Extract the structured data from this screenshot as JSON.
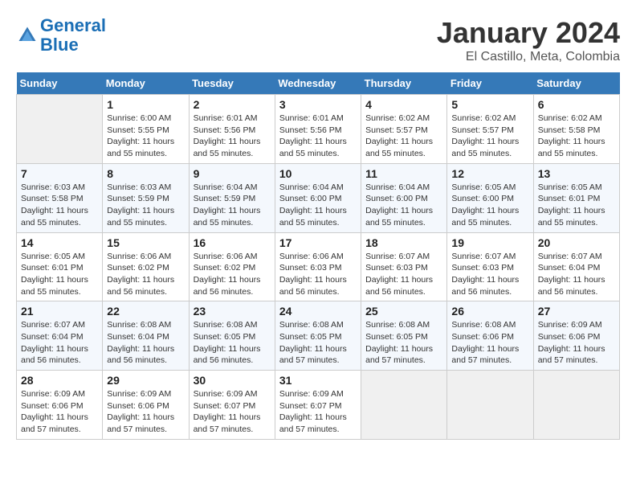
{
  "header": {
    "logo_line1": "General",
    "logo_line2": "Blue",
    "title": "January 2024",
    "subtitle": "El Castillo, Meta, Colombia"
  },
  "weekdays": [
    "Sunday",
    "Monday",
    "Tuesday",
    "Wednesday",
    "Thursday",
    "Friday",
    "Saturday"
  ],
  "weeks": [
    [
      {
        "day": "",
        "info": ""
      },
      {
        "day": "1",
        "info": "Sunrise: 6:00 AM\nSunset: 5:55 PM\nDaylight: 11 hours\nand 55 minutes."
      },
      {
        "day": "2",
        "info": "Sunrise: 6:01 AM\nSunset: 5:56 PM\nDaylight: 11 hours\nand 55 minutes."
      },
      {
        "day": "3",
        "info": "Sunrise: 6:01 AM\nSunset: 5:56 PM\nDaylight: 11 hours\nand 55 minutes."
      },
      {
        "day": "4",
        "info": "Sunrise: 6:02 AM\nSunset: 5:57 PM\nDaylight: 11 hours\nand 55 minutes."
      },
      {
        "day": "5",
        "info": "Sunrise: 6:02 AM\nSunset: 5:57 PM\nDaylight: 11 hours\nand 55 minutes."
      },
      {
        "day": "6",
        "info": "Sunrise: 6:02 AM\nSunset: 5:58 PM\nDaylight: 11 hours\nand 55 minutes."
      }
    ],
    [
      {
        "day": "7",
        "info": "Sunrise: 6:03 AM\nSunset: 5:58 PM\nDaylight: 11 hours\nand 55 minutes."
      },
      {
        "day": "8",
        "info": "Sunrise: 6:03 AM\nSunset: 5:59 PM\nDaylight: 11 hours\nand 55 minutes."
      },
      {
        "day": "9",
        "info": "Sunrise: 6:04 AM\nSunset: 5:59 PM\nDaylight: 11 hours\nand 55 minutes."
      },
      {
        "day": "10",
        "info": "Sunrise: 6:04 AM\nSunset: 6:00 PM\nDaylight: 11 hours\nand 55 minutes."
      },
      {
        "day": "11",
        "info": "Sunrise: 6:04 AM\nSunset: 6:00 PM\nDaylight: 11 hours\nand 55 minutes."
      },
      {
        "day": "12",
        "info": "Sunrise: 6:05 AM\nSunset: 6:00 PM\nDaylight: 11 hours\nand 55 minutes."
      },
      {
        "day": "13",
        "info": "Sunrise: 6:05 AM\nSunset: 6:01 PM\nDaylight: 11 hours\nand 55 minutes."
      }
    ],
    [
      {
        "day": "14",
        "info": "Sunrise: 6:05 AM\nSunset: 6:01 PM\nDaylight: 11 hours\nand 55 minutes."
      },
      {
        "day": "15",
        "info": "Sunrise: 6:06 AM\nSunset: 6:02 PM\nDaylight: 11 hours\nand 56 minutes."
      },
      {
        "day": "16",
        "info": "Sunrise: 6:06 AM\nSunset: 6:02 PM\nDaylight: 11 hours\nand 56 minutes."
      },
      {
        "day": "17",
        "info": "Sunrise: 6:06 AM\nSunset: 6:03 PM\nDaylight: 11 hours\nand 56 minutes."
      },
      {
        "day": "18",
        "info": "Sunrise: 6:07 AM\nSunset: 6:03 PM\nDaylight: 11 hours\nand 56 minutes."
      },
      {
        "day": "19",
        "info": "Sunrise: 6:07 AM\nSunset: 6:03 PM\nDaylight: 11 hours\nand 56 minutes."
      },
      {
        "day": "20",
        "info": "Sunrise: 6:07 AM\nSunset: 6:04 PM\nDaylight: 11 hours\nand 56 minutes."
      }
    ],
    [
      {
        "day": "21",
        "info": "Sunrise: 6:07 AM\nSunset: 6:04 PM\nDaylight: 11 hours\nand 56 minutes."
      },
      {
        "day": "22",
        "info": "Sunrise: 6:08 AM\nSunset: 6:04 PM\nDaylight: 11 hours\nand 56 minutes."
      },
      {
        "day": "23",
        "info": "Sunrise: 6:08 AM\nSunset: 6:05 PM\nDaylight: 11 hours\nand 56 minutes."
      },
      {
        "day": "24",
        "info": "Sunrise: 6:08 AM\nSunset: 6:05 PM\nDaylight: 11 hours\nand 57 minutes."
      },
      {
        "day": "25",
        "info": "Sunrise: 6:08 AM\nSunset: 6:05 PM\nDaylight: 11 hours\nand 57 minutes."
      },
      {
        "day": "26",
        "info": "Sunrise: 6:08 AM\nSunset: 6:06 PM\nDaylight: 11 hours\nand 57 minutes."
      },
      {
        "day": "27",
        "info": "Sunrise: 6:09 AM\nSunset: 6:06 PM\nDaylight: 11 hours\nand 57 minutes."
      }
    ],
    [
      {
        "day": "28",
        "info": "Sunrise: 6:09 AM\nSunset: 6:06 PM\nDaylight: 11 hours\nand 57 minutes."
      },
      {
        "day": "29",
        "info": "Sunrise: 6:09 AM\nSunset: 6:06 PM\nDaylight: 11 hours\nand 57 minutes."
      },
      {
        "day": "30",
        "info": "Sunrise: 6:09 AM\nSunset: 6:07 PM\nDaylight: 11 hours\nand 57 minutes."
      },
      {
        "day": "31",
        "info": "Sunrise: 6:09 AM\nSunset: 6:07 PM\nDaylight: 11 hours\nand 57 minutes."
      },
      {
        "day": "",
        "info": ""
      },
      {
        "day": "",
        "info": ""
      },
      {
        "day": "",
        "info": ""
      }
    ]
  ]
}
